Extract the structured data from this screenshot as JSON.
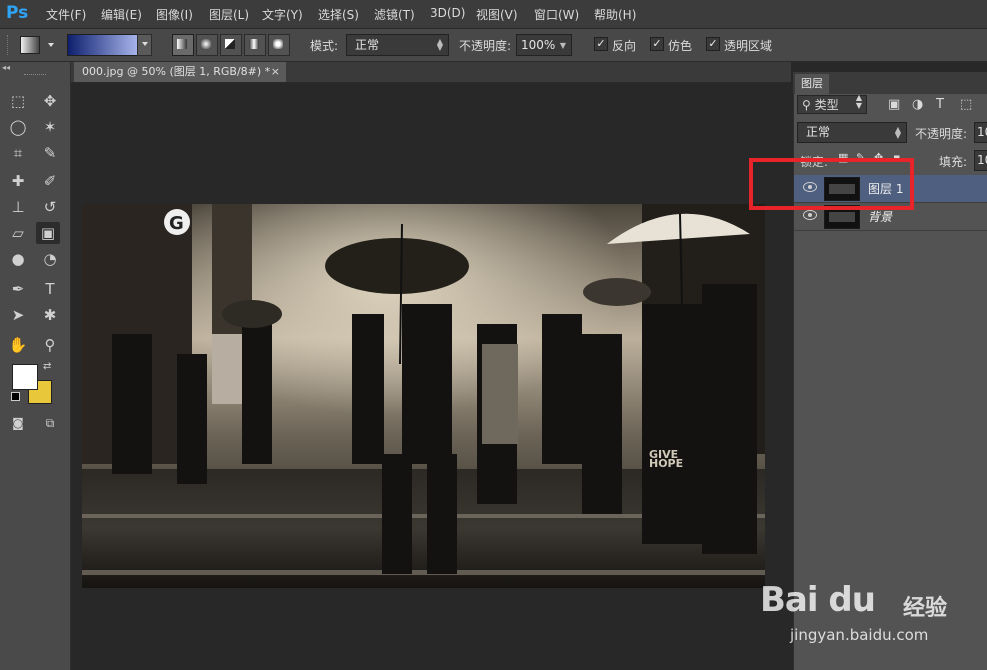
{
  "app": {
    "logo": "Ps"
  },
  "menu": [
    "文件(F)",
    "编辑(E)",
    "图像(I)",
    "图层(L)",
    "文字(Y)",
    "选择(S)",
    "滤镜(T)",
    "3D(D)",
    "视图(V)",
    "窗口(W)",
    "帮助(H)"
  ],
  "options": {
    "gradient_colors": [
      "#0e1f6e",
      "#a9b6ec"
    ],
    "mode_label": "模式:",
    "mode_value": "正常",
    "opacity_label": "不透明度:",
    "opacity_value": "100%",
    "reverse_label": "反向",
    "dither_label": "仿色",
    "transparency_label": "透明区域"
  },
  "toolbar": {
    "foreground_color": "#ffffff",
    "background_color": "#e8c73a",
    "active_tool": "gradient-tool"
  },
  "document": {
    "tab_title": "000.jpg @ 50% (图层 1, RGB/8#) *",
    "close_glyph": "×",
    "image_text": {
      "sign_letter": "G",
      "give": "GIVE",
      "hope": "HOPE"
    }
  },
  "layers_panel": {
    "tab": "图层",
    "filter_label": "类型",
    "blend_mode": "正常",
    "opacity_label": "不透明度:",
    "opacity_value": "10",
    "lock_label": "锁定:",
    "fill_label": "填充:",
    "fill_value": "10",
    "layers": [
      {
        "name": "图层 1",
        "selected": true
      },
      {
        "name": "背景",
        "selected": false
      }
    ]
  },
  "watermark": {
    "brand": "Bai du",
    "suffix": "经验",
    "url": "jingyan.baidu.com"
  },
  "colors": {
    "accent_highlight": "#e8242b",
    "selected_layer": "#4f5f7f",
    "panel_bg": "#535353"
  }
}
